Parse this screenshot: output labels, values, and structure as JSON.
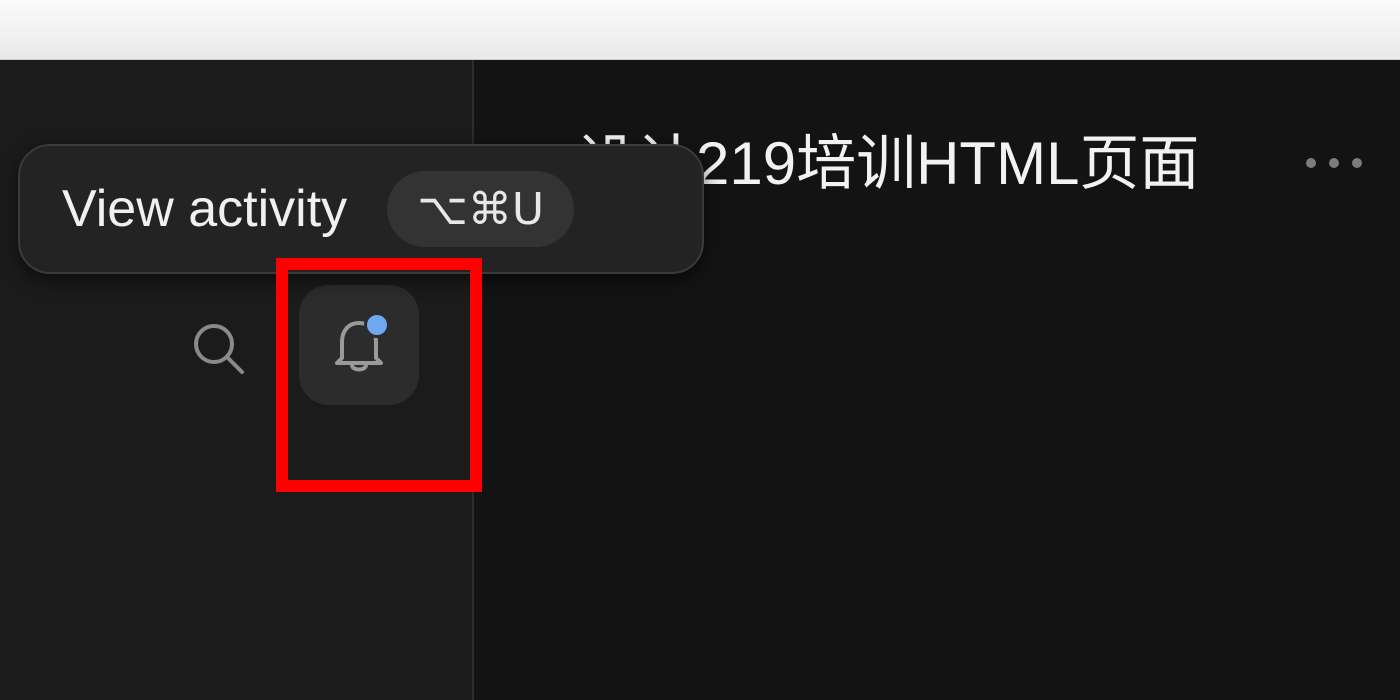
{
  "document": {
    "title": "设计219培训HTML页面"
  },
  "tooltip": {
    "label": "View activity",
    "shortcut": "⌥⌘U"
  },
  "icons": {
    "more": "more-horizontal-icon",
    "search": "search-icon",
    "bell": "bell-icon"
  },
  "notifications": {
    "has_unread": true
  },
  "colors": {
    "unread_dot": "#6ea8f0",
    "highlight": "#ff0000",
    "main_background": "#131313",
    "sidebar_background": "#1b1b1b"
  }
}
